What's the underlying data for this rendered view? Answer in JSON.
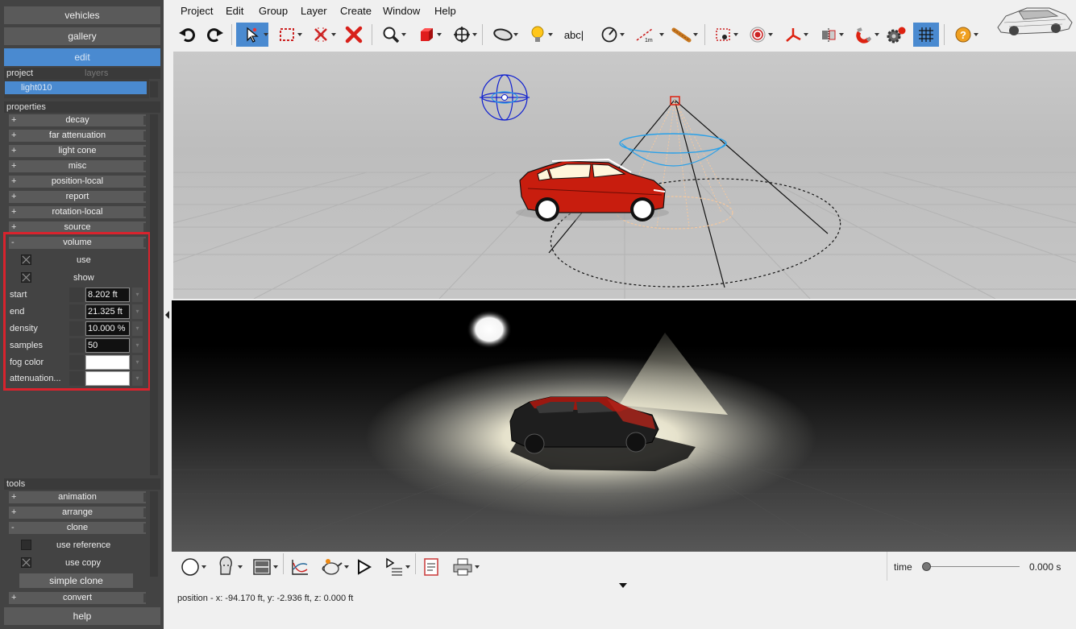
{
  "nav": {
    "vehicles": "vehicles",
    "gallery": "gallery",
    "edit": "edit",
    "help": "help"
  },
  "panel": {
    "tab_project": "project",
    "tab_layers": "layers",
    "tree_item": "light010",
    "properties_title": "properties",
    "tools_title": "tools"
  },
  "properties": {
    "groups": [
      {
        "sign": "+",
        "label": "decay"
      },
      {
        "sign": "+",
        "label": "far attenuation"
      },
      {
        "sign": "+",
        "label": "light cone"
      },
      {
        "sign": "+",
        "label": "misc"
      },
      {
        "sign": "+",
        "label": "position-local"
      },
      {
        "sign": "+",
        "label": "report"
      },
      {
        "sign": "+",
        "label": "rotation-local"
      },
      {
        "sign": "+",
        "label": "source"
      },
      {
        "sign": "-",
        "label": "volume"
      }
    ],
    "volume": {
      "use_label": "use",
      "use_checked": true,
      "show_label": "show",
      "show_checked": true,
      "start_label": "start",
      "start_value": "8.202 ft",
      "end_label": "end",
      "end_value": "21.325 ft",
      "density_label": "density",
      "density_value": "10.000 %",
      "samples_label": "samples",
      "samples_value": "50",
      "fog_color_label": "fog color",
      "fog_color": "#ffffff",
      "attenuation_label": "attenuation...",
      "attenuation_color": "#ffffff"
    }
  },
  "tools": {
    "groups": [
      {
        "sign": "+",
        "label": "animation"
      },
      {
        "sign": "+",
        "label": "arrange"
      },
      {
        "sign": "-",
        "label": "clone"
      }
    ],
    "clone": {
      "use_reference_label": "use reference",
      "use_reference_checked": false,
      "use_copy_label": "use copy",
      "use_copy_checked": true,
      "simple_clone_label": "simple clone"
    },
    "after": [
      {
        "sign": "+",
        "label": "convert"
      }
    ]
  },
  "menu": [
    "Project",
    "Edit",
    "Group",
    "Layer",
    "Create",
    "Window",
    "Help"
  ],
  "toolbar": {
    "icons": [
      "undo-icon",
      "redo-icon",
      "select-arrow-icon",
      "marquee-select-icon",
      "unlink-icon",
      "delete-icon",
      "zoom-icon",
      "cube-icon",
      "move-icon",
      "ellipse-icon",
      "light-bulb-icon",
      "text-icon",
      "measure-angle-icon",
      "measure-distance-icon",
      "ruler-icon",
      "camera-icon",
      "target-icon",
      "axis-icon",
      "mirror-icon",
      "magnet-icon",
      "settings-icon",
      "grid-icon",
      "help-icon"
    ],
    "text_tool_label": "abc|",
    "measure_label": "1m"
  },
  "status": {
    "position": "position - x: -94.170 ft, y: -2.936 ft, z: 0.000 ft"
  },
  "timeline": {
    "label": "time",
    "value": "0.000 s",
    "progress": 0
  },
  "colors": {
    "panel_bg": "#434343",
    "accent": "#4a8ad0",
    "highlight": "#d9232d",
    "car_body": "#c81d0e"
  }
}
